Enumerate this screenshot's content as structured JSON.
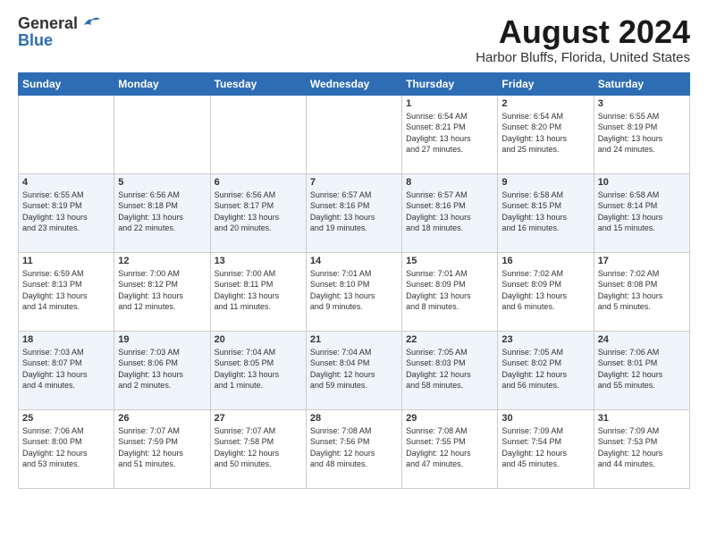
{
  "header": {
    "logo_general": "General",
    "logo_blue": "Blue",
    "month_title": "August 2024",
    "location": "Harbor Bluffs, Florida, United States"
  },
  "days_of_week": [
    "Sunday",
    "Monday",
    "Tuesday",
    "Wednesday",
    "Thursday",
    "Friday",
    "Saturday"
  ],
  "weeks": [
    [
      {
        "day": "",
        "info": ""
      },
      {
        "day": "",
        "info": ""
      },
      {
        "day": "",
        "info": ""
      },
      {
        "day": "",
        "info": ""
      },
      {
        "day": "1",
        "info": "Sunrise: 6:54 AM\nSunset: 8:21 PM\nDaylight: 13 hours\nand 27 minutes."
      },
      {
        "day": "2",
        "info": "Sunrise: 6:54 AM\nSunset: 8:20 PM\nDaylight: 13 hours\nand 25 minutes."
      },
      {
        "day": "3",
        "info": "Sunrise: 6:55 AM\nSunset: 8:19 PM\nDaylight: 13 hours\nand 24 minutes."
      }
    ],
    [
      {
        "day": "4",
        "info": "Sunrise: 6:55 AM\nSunset: 8:19 PM\nDaylight: 13 hours\nand 23 minutes."
      },
      {
        "day": "5",
        "info": "Sunrise: 6:56 AM\nSunset: 8:18 PM\nDaylight: 13 hours\nand 22 minutes."
      },
      {
        "day": "6",
        "info": "Sunrise: 6:56 AM\nSunset: 8:17 PM\nDaylight: 13 hours\nand 20 minutes."
      },
      {
        "day": "7",
        "info": "Sunrise: 6:57 AM\nSunset: 8:16 PM\nDaylight: 13 hours\nand 19 minutes."
      },
      {
        "day": "8",
        "info": "Sunrise: 6:57 AM\nSunset: 8:16 PM\nDaylight: 13 hours\nand 18 minutes."
      },
      {
        "day": "9",
        "info": "Sunrise: 6:58 AM\nSunset: 8:15 PM\nDaylight: 13 hours\nand 16 minutes."
      },
      {
        "day": "10",
        "info": "Sunrise: 6:58 AM\nSunset: 8:14 PM\nDaylight: 13 hours\nand 15 minutes."
      }
    ],
    [
      {
        "day": "11",
        "info": "Sunrise: 6:59 AM\nSunset: 8:13 PM\nDaylight: 13 hours\nand 14 minutes."
      },
      {
        "day": "12",
        "info": "Sunrise: 7:00 AM\nSunset: 8:12 PM\nDaylight: 13 hours\nand 12 minutes."
      },
      {
        "day": "13",
        "info": "Sunrise: 7:00 AM\nSunset: 8:11 PM\nDaylight: 13 hours\nand 11 minutes."
      },
      {
        "day": "14",
        "info": "Sunrise: 7:01 AM\nSunset: 8:10 PM\nDaylight: 13 hours\nand 9 minutes."
      },
      {
        "day": "15",
        "info": "Sunrise: 7:01 AM\nSunset: 8:09 PM\nDaylight: 13 hours\nand 8 minutes."
      },
      {
        "day": "16",
        "info": "Sunrise: 7:02 AM\nSunset: 8:09 PM\nDaylight: 13 hours\nand 6 minutes."
      },
      {
        "day": "17",
        "info": "Sunrise: 7:02 AM\nSunset: 8:08 PM\nDaylight: 13 hours\nand 5 minutes."
      }
    ],
    [
      {
        "day": "18",
        "info": "Sunrise: 7:03 AM\nSunset: 8:07 PM\nDaylight: 13 hours\nand 4 minutes."
      },
      {
        "day": "19",
        "info": "Sunrise: 7:03 AM\nSunset: 8:06 PM\nDaylight: 13 hours\nand 2 minutes."
      },
      {
        "day": "20",
        "info": "Sunrise: 7:04 AM\nSunset: 8:05 PM\nDaylight: 13 hours\nand 1 minute."
      },
      {
        "day": "21",
        "info": "Sunrise: 7:04 AM\nSunset: 8:04 PM\nDaylight: 12 hours\nand 59 minutes."
      },
      {
        "day": "22",
        "info": "Sunrise: 7:05 AM\nSunset: 8:03 PM\nDaylight: 12 hours\nand 58 minutes."
      },
      {
        "day": "23",
        "info": "Sunrise: 7:05 AM\nSunset: 8:02 PM\nDaylight: 12 hours\nand 56 minutes."
      },
      {
        "day": "24",
        "info": "Sunrise: 7:06 AM\nSunset: 8:01 PM\nDaylight: 12 hours\nand 55 minutes."
      }
    ],
    [
      {
        "day": "25",
        "info": "Sunrise: 7:06 AM\nSunset: 8:00 PM\nDaylight: 12 hours\nand 53 minutes."
      },
      {
        "day": "26",
        "info": "Sunrise: 7:07 AM\nSunset: 7:59 PM\nDaylight: 12 hours\nand 51 minutes."
      },
      {
        "day": "27",
        "info": "Sunrise: 7:07 AM\nSunset: 7:58 PM\nDaylight: 12 hours\nand 50 minutes."
      },
      {
        "day": "28",
        "info": "Sunrise: 7:08 AM\nSunset: 7:56 PM\nDaylight: 12 hours\nand 48 minutes."
      },
      {
        "day": "29",
        "info": "Sunrise: 7:08 AM\nSunset: 7:55 PM\nDaylight: 12 hours\nand 47 minutes."
      },
      {
        "day": "30",
        "info": "Sunrise: 7:09 AM\nSunset: 7:54 PM\nDaylight: 12 hours\nand 45 minutes."
      },
      {
        "day": "31",
        "info": "Sunrise: 7:09 AM\nSunset: 7:53 PM\nDaylight: 12 hours\nand 44 minutes."
      }
    ]
  ]
}
